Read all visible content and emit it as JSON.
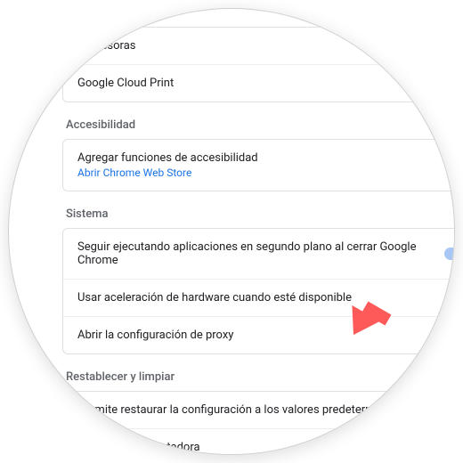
{
  "sections": {
    "printers": {
      "items": [
        "Impresoras",
        "Google Cloud Print"
      ]
    },
    "accessibility": {
      "title": "Accesibilidad",
      "item_label": "Agregar funciones de accesibilidad",
      "item_sub": "Abrir Chrome Web Store"
    },
    "system": {
      "title": "Sistema",
      "background_apps": "Seguir ejecutando aplicaciones en segundo plano al cerrar Google Chrome",
      "hw_accel": "Usar aceleración de hardware cuando esté disponible",
      "proxy": "Abrir la configuración de proxy"
    },
    "reset": {
      "title": "Restablecer y limpiar",
      "restore": "Permite restaurar la configuración a los valores predeterminados originales",
      "cleanup": "Limpiar la computadora"
    }
  },
  "toggles": {
    "background_apps": true,
    "hw_accel": true
  },
  "colors": {
    "accent": "#1a73e8",
    "arrow": "#ff5a5a"
  }
}
